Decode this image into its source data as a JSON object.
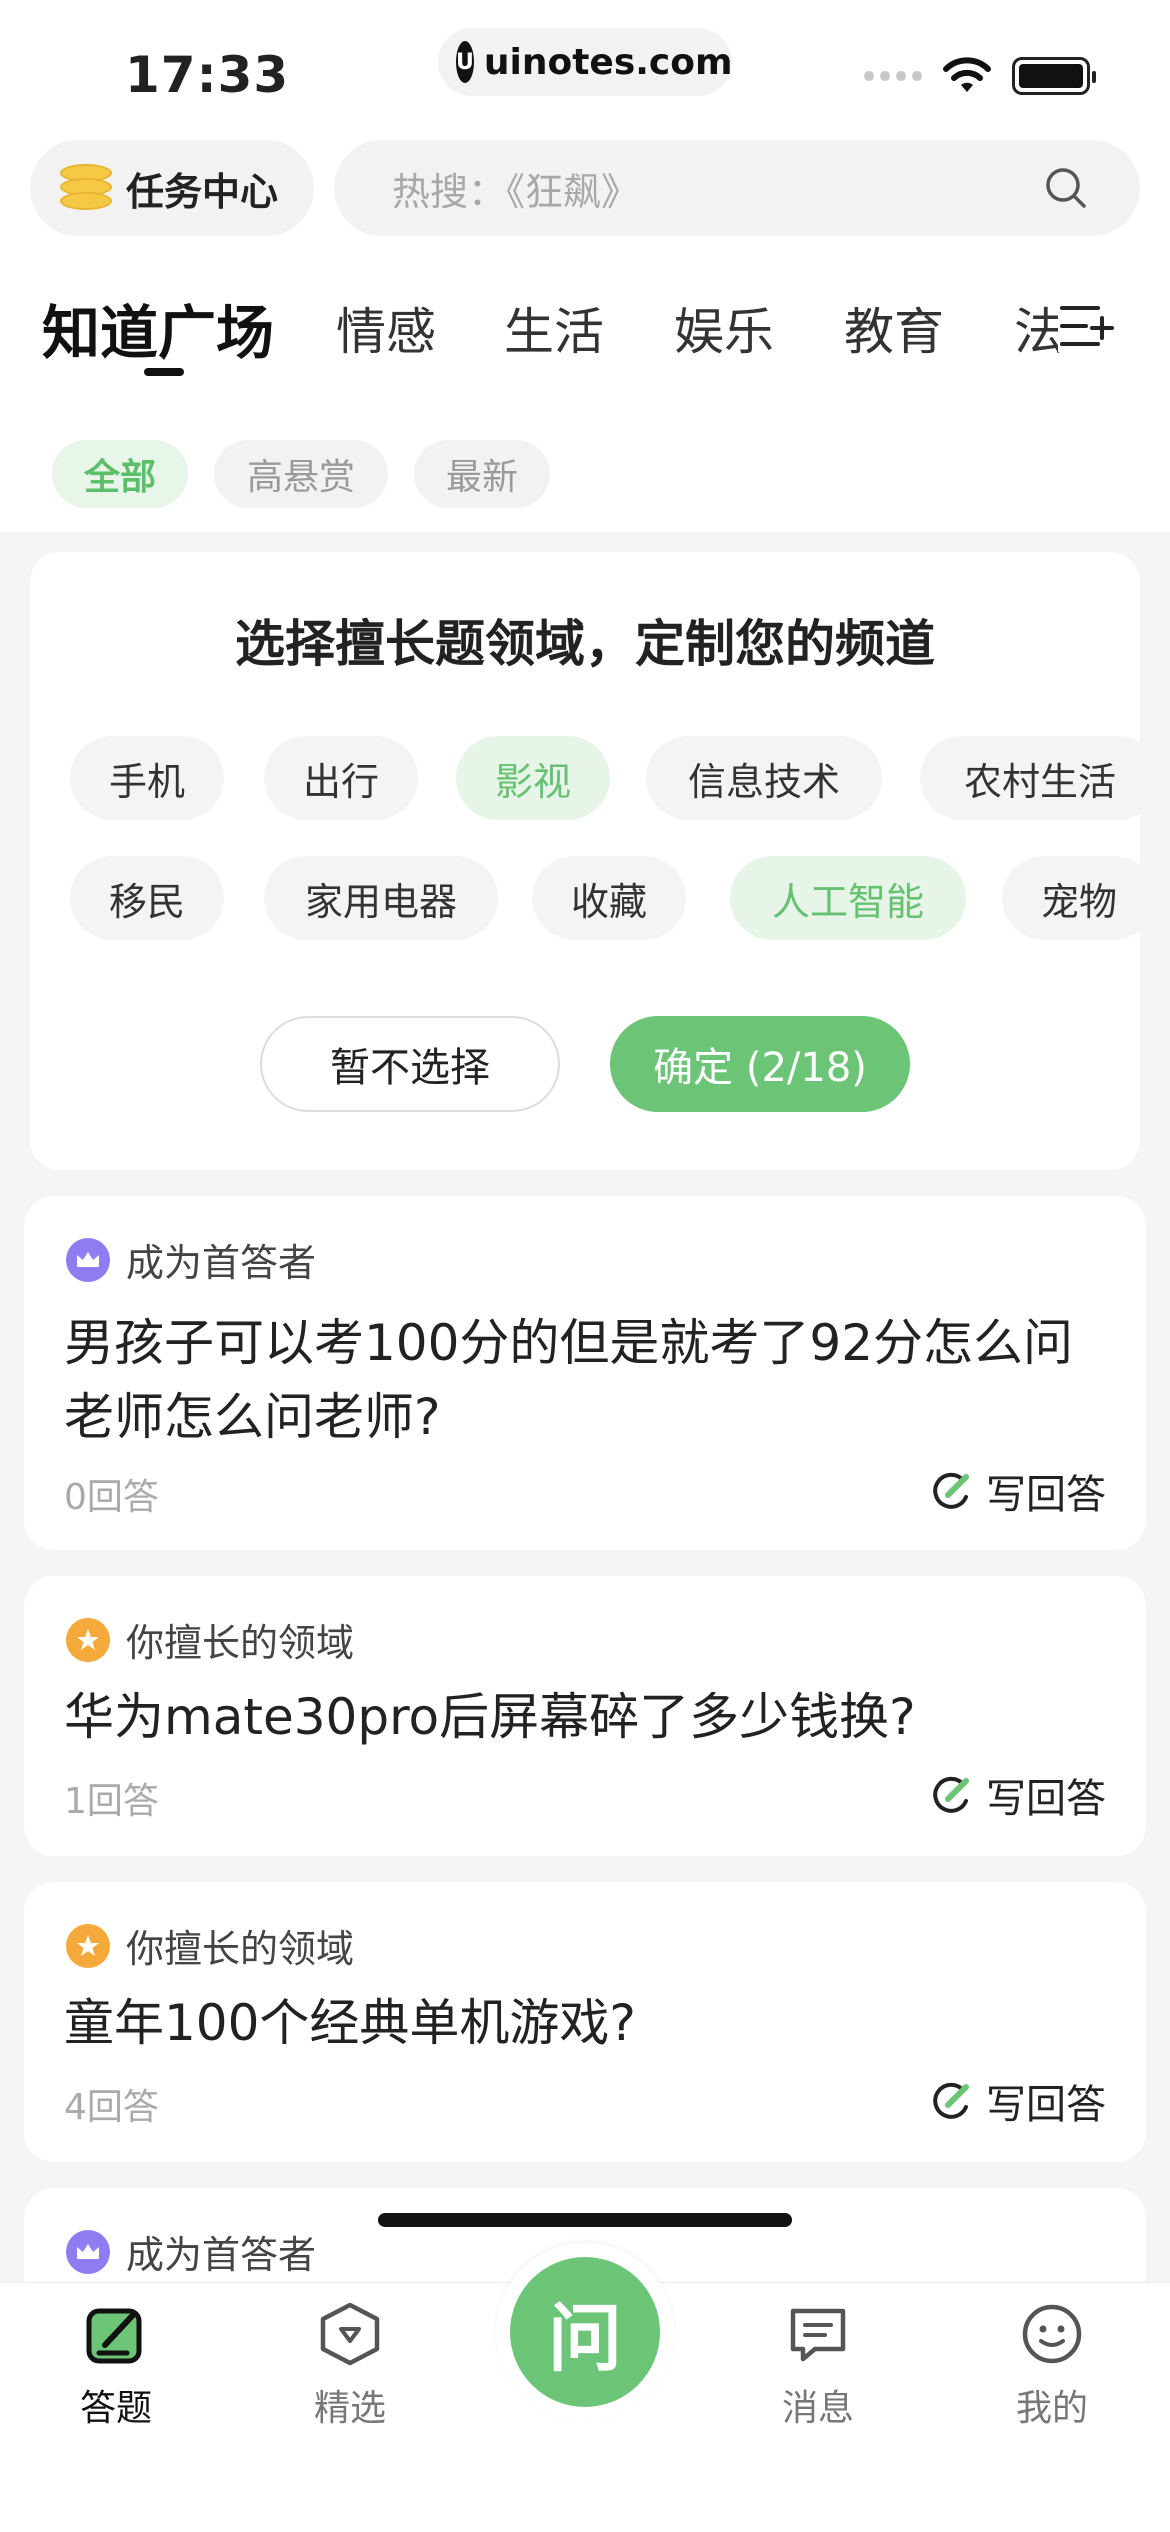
{
  "status": {
    "time": "17:33",
    "url": "uinotes.com"
  },
  "header": {
    "task_center": "任务中心",
    "search_placeholder": "热搜：《狂飙》"
  },
  "tabs": [
    {
      "label": "知道广场",
      "active": true
    },
    {
      "label": "情感"
    },
    {
      "label": "生活"
    },
    {
      "label": "娱乐"
    },
    {
      "label": "教育"
    },
    {
      "label": "法"
    }
  ],
  "filters": [
    {
      "label": "全部",
      "active": true
    },
    {
      "label": "高悬赏"
    },
    {
      "label": "最新"
    }
  ],
  "domain_picker": {
    "title": "选择擅长题领域，定制您的频道",
    "row1": [
      "手机",
      "出行",
      "影视",
      "信息技术",
      "农村生活"
    ],
    "row2": [
      "移民",
      "家用电器",
      "收藏",
      "人工智能",
      "宠物"
    ],
    "selected": [
      "影视",
      "人工智能"
    ],
    "skip_label": "暂不选择",
    "confirm_label": "确定 (2/18)"
  },
  "questions": [
    {
      "tag": "成为首答者",
      "tag_type": "crown",
      "title": "男孩子可以考100分的但是就考了92分怎么问老师怎么问老师?",
      "count": "0回答",
      "action": "写回答"
    },
    {
      "tag": "你擅长的领域",
      "tag_type": "star",
      "title": "华为mate30pro后屏幕碎了多少钱换?",
      "count": "1回答",
      "action": "写回答"
    },
    {
      "tag": "你擅长的领域",
      "tag_type": "star",
      "title": "童年100个经典单机游戏?",
      "count": "4回答",
      "action": "写回答"
    },
    {
      "tag": "成为首答者",
      "tag_type": "crown"
    }
  ],
  "bottom_nav": {
    "answer": "答题",
    "featured": "精选",
    "ask": "问",
    "messages": "消息",
    "me": "我的"
  },
  "colors": {
    "accent": "#6cc477",
    "chip_selected_bg": "#e6f5e8"
  }
}
